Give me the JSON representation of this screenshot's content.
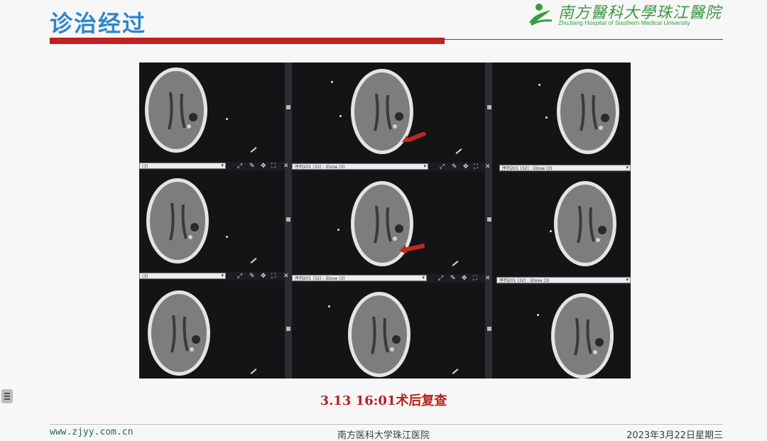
{
  "slide": {
    "title": "诊治经过",
    "caption": "3.13 16:01术后复查"
  },
  "logo": {
    "cn_name": "南方醫科大學珠江醫院",
    "en_name": "ZhuJiang Hospital of Southern Medical University"
  },
  "ct_viewer": {
    "series_left": "(3)",
    "series_label": "序列201 (32) : iDose (3)",
    "series_short": "序列201 (32) : iDose (3)"
  },
  "footer": {
    "website": "www.zjyy.com.cn",
    "hospital": "南方医科大学珠江医院",
    "date": "2023年3月22日星期三"
  },
  "colors": {
    "title_blue": "#2e86c8",
    "accent_red": "#c0201f",
    "logo_green": "#3b9a45",
    "caption_red": "#b8211e"
  }
}
